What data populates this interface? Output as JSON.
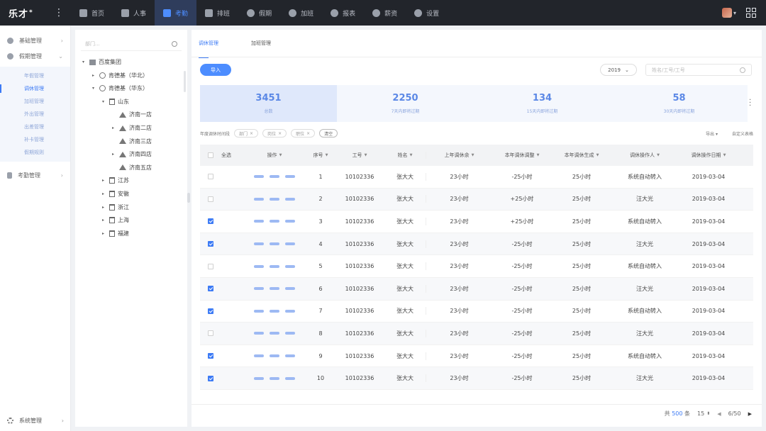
{
  "app": {
    "logo": "乐才",
    "logo_mark": "*",
    "menu_icon": "⋮"
  },
  "topnav": [
    {
      "label": "首页",
      "icon": "home-icon",
      "active": false
    },
    {
      "label": "人事",
      "icon": "person-icon",
      "active": false
    },
    {
      "label": "考勤",
      "icon": "calendar-icon",
      "active": true
    },
    {
      "label": "排班",
      "icon": "schedule-icon",
      "active": false
    },
    {
      "label": "假期",
      "icon": "vacation-icon",
      "active": false
    },
    {
      "label": "加班",
      "icon": "clock-icon",
      "active": false
    },
    {
      "label": "报表",
      "icon": "report-icon",
      "active": false
    },
    {
      "label": "薪资",
      "icon": "money-icon",
      "active": false
    },
    {
      "label": "设置",
      "icon": "settings-icon",
      "active": false
    }
  ],
  "sidebar": {
    "groups": [
      {
        "label": "基础管理",
        "arrow": "›"
      },
      {
        "label": "假期管理",
        "arrow": "⌄"
      }
    ],
    "sub_items": [
      {
        "label": "年假管理",
        "active": false
      },
      {
        "label": "调休管理",
        "active": true
      },
      {
        "label": "加班管理",
        "active": false
      },
      {
        "label": "外出管理",
        "active": false
      },
      {
        "label": "出差管理",
        "active": false
      },
      {
        "label": "补卡管理",
        "active": false
      },
      {
        "label": "假期规则",
        "active": false
      }
    ],
    "group3": {
      "label": "考勤管理",
      "arrow": "›"
    },
    "bottom": {
      "label": "系统管理",
      "arrow": "›"
    }
  },
  "tree": {
    "search_placeholder": "部门...",
    "nodes": [
      {
        "label": "百度集团",
        "level": 0,
        "expander": "▾",
        "icon": "org"
      },
      {
        "label": "肯德基（华北）",
        "level": 1,
        "expander": "▸",
        "icon": "globe"
      },
      {
        "label": "肯德基（华东）",
        "level": 1,
        "expander": "▾",
        "icon": "globe"
      },
      {
        "label": "山东",
        "level": 2,
        "expander": "▾",
        "icon": "bld"
      },
      {
        "label": "济南一店",
        "level": 3,
        "expander": "",
        "icon": "home"
      },
      {
        "label": "济南二店",
        "level": 3,
        "expander": "▸",
        "icon": "home"
      },
      {
        "label": "济南三店",
        "level": 3,
        "expander": "",
        "icon": "home"
      },
      {
        "label": "济南四店",
        "level": 3,
        "expander": "▸",
        "icon": "home"
      },
      {
        "label": "济南五店",
        "level": 3,
        "expander": "",
        "icon": "home"
      },
      {
        "label": "江苏",
        "level": 2,
        "expander": "▸",
        "icon": "bld"
      },
      {
        "label": "安徽",
        "level": 2,
        "expander": "▸",
        "icon": "bld"
      },
      {
        "label": "浙江",
        "level": 2,
        "expander": "▸",
        "icon": "bld"
      },
      {
        "label": "上海",
        "level": 2,
        "expander": "▸",
        "icon": "bld"
      },
      {
        "label": "福建",
        "level": 2,
        "expander": "▸",
        "icon": "bld"
      }
    ]
  },
  "main": {
    "tabs": [
      {
        "label": "调休管理",
        "active": true
      },
      {
        "label": "加班管理",
        "active": false
      }
    ],
    "import_label": "导入",
    "year": "2019",
    "search_placeholder": "姓名/工号/工号",
    "stats": [
      {
        "value": "3451",
        "label": "总数",
        "active": true
      },
      {
        "value": "2250",
        "label": "7天内即将过期",
        "active": false
      },
      {
        "value": "134",
        "label": "15天内即将过期",
        "active": false
      },
      {
        "value": "58",
        "label": "30天内即将过期",
        "active": false
      }
    ],
    "filter": {
      "label": "年度调休时间段",
      "chips": [
        "部门",
        "岗位",
        "职位"
      ],
      "reset": "清空",
      "export": "导出",
      "custom": "自定义表格"
    },
    "columns": {
      "all": "全选",
      "op": "操作",
      "seq": "序号",
      "id": "工号",
      "name": "姓名",
      "last": "上年调休余",
      "adj": "本年调休调整",
      "gen": "本年调休生成",
      "rec": "调休操作人",
      "date": "调休操作日期"
    },
    "rows": [
      {
        "checked": false,
        "seq": "1",
        "id": "10102336",
        "name": "张大大",
        "last": "23小时",
        "adj": "-25小时",
        "gen": "25小时",
        "rec": "系统自动转入",
        "date": "2019-03-04"
      },
      {
        "checked": false,
        "seq": "2",
        "id": "10102336",
        "name": "张大大",
        "last": "23小时",
        "adj": "+25小时",
        "gen": "25小时",
        "rec": "汪大光",
        "date": "2019-03-04"
      },
      {
        "checked": true,
        "seq": "3",
        "id": "10102336",
        "name": "张大大",
        "last": "23小时",
        "adj": "+25小时",
        "gen": "25小时",
        "rec": "系统自动转入",
        "date": "2019-03-04"
      },
      {
        "checked": true,
        "seq": "4",
        "id": "10102336",
        "name": "张大大",
        "last": "23小时",
        "adj": "-25小时",
        "gen": "25小时",
        "rec": "汪大光",
        "date": "2019-03-04"
      },
      {
        "checked": false,
        "seq": "5",
        "id": "10102336",
        "name": "张大大",
        "last": "23小时",
        "adj": "-25小时",
        "gen": "25小时",
        "rec": "系统自动转入",
        "date": "2019-03-04"
      },
      {
        "checked": true,
        "seq": "6",
        "id": "10102336",
        "name": "张大大",
        "last": "23小时",
        "adj": "-25小时",
        "gen": "25小时",
        "rec": "汪大光",
        "date": "2019-03-04"
      },
      {
        "checked": true,
        "seq": "7",
        "id": "10102336",
        "name": "张大大",
        "last": "23小时",
        "adj": "-25小时",
        "gen": "25小时",
        "rec": "系统自动转入",
        "date": "2019-03-04"
      },
      {
        "checked": false,
        "seq": "8",
        "id": "10102336",
        "name": "张大大",
        "last": "23小时",
        "adj": "-25小时",
        "gen": "25小时",
        "rec": "汪大光",
        "date": "2019-03-04"
      },
      {
        "checked": true,
        "seq": "9",
        "id": "10102336",
        "name": "张大大",
        "last": "23小时",
        "adj": "-25小时",
        "gen": "25小时",
        "rec": "系统自动转入",
        "date": "2019-03-04"
      },
      {
        "checked": true,
        "seq": "10",
        "id": "10102336",
        "name": "张大大",
        "last": "23小时",
        "adj": "-25小时",
        "gen": "25小时",
        "rec": "汪大光",
        "date": "2019-03-04"
      }
    ],
    "pager": {
      "total_prefix": "共",
      "total": "500",
      "total_suffix": "条",
      "page_size": "15",
      "page": "6/50"
    }
  },
  "colors": {
    "accent": "#3d7bf5",
    "topbar": "#22252b"
  }
}
